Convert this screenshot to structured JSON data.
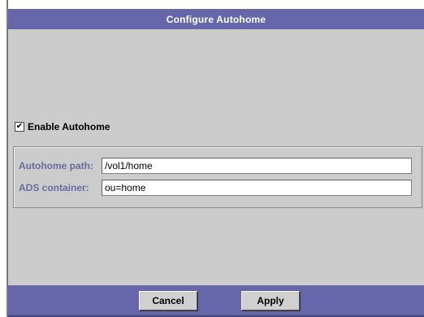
{
  "dialog": {
    "title": "Configure Autohome"
  },
  "enable_autohome": {
    "label": "Enable Autohome",
    "checked": true,
    "check_glyph": "✔"
  },
  "fields": {
    "autohome_path": {
      "label": "Autohome path:",
      "value": "/vol1/home"
    },
    "ads_container": {
      "label": "ADS container:",
      "value": "ou=home"
    }
  },
  "buttons": {
    "cancel_label": "Cancel",
    "apply_label": "Apply"
  },
  "colors": {
    "title_bar": "#6666aa",
    "panel_bg": "#cccccc",
    "field_label": "#6a6aa0"
  }
}
